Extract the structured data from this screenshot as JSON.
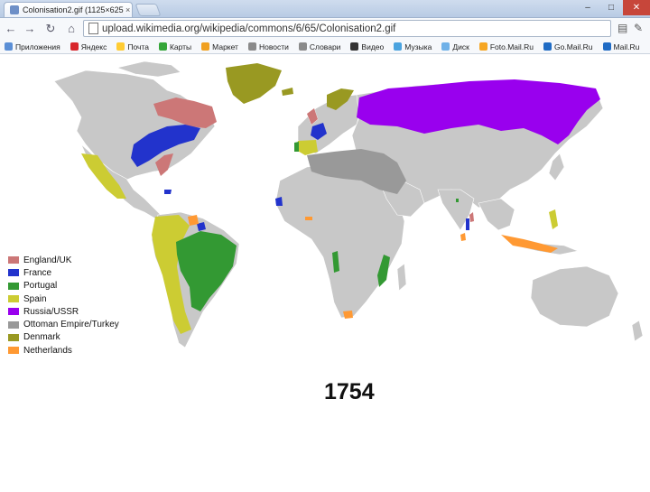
{
  "browser": {
    "tab_title": "Colonisation2.gif (1125×625)",
    "tab_close": "×",
    "url": "upload.wikimedia.org/wikipedia/commons/6/65/Colonisation2.gif",
    "window_controls": {
      "minimize": "–",
      "maximize": "□",
      "close": "✕"
    },
    "nav": {
      "back": "←",
      "forward": "→",
      "reload": "↻",
      "home": "⌂"
    },
    "right_icons": {
      "page": "▤",
      "wrench": "✎"
    }
  },
  "bookmarks": [
    {
      "label": "Приложения",
      "color": "#5b8fd6",
      "icon": "apps-icon"
    },
    {
      "label": "Яндекс",
      "color": "#d8262b",
      "icon": "yandex-icon"
    },
    {
      "label": "Почта",
      "color": "#ffcc33",
      "icon": "mail-icon"
    },
    {
      "label": "Карты",
      "color": "#35a63a",
      "icon": "maps-icon"
    },
    {
      "label": "Маркет",
      "color": "#f0a020",
      "icon": "market-icon"
    },
    {
      "label": "Новости",
      "color": "#8a8a8a",
      "icon": "news-icon"
    },
    {
      "label": "Словари",
      "color": "#8a8a8a",
      "icon": "dictionary-icon"
    },
    {
      "label": "Видео",
      "color": "#333333",
      "icon": "video-icon"
    },
    {
      "label": "Музыка",
      "color": "#4aa3df",
      "icon": "music-icon"
    },
    {
      "label": "Диск",
      "color": "#6fb1e8",
      "icon": "disk-icon"
    },
    {
      "label": "Foto.Mail.Ru",
      "color": "#f6a623",
      "icon": "foto-mail-icon"
    },
    {
      "label": "Go.Mail.Ru",
      "color": "#1f6bc4",
      "icon": "go-mail-icon"
    },
    {
      "label": "Mail.Ru",
      "color": "#1f6bc4",
      "icon": "mail-ru-icon"
    }
  ],
  "map": {
    "year": "1754",
    "land_color": "#c8c8c8",
    "legend": [
      {
        "label": "England/UK",
        "color": "#cc7777"
      },
      {
        "label": "France",
        "color": "#2233cc"
      },
      {
        "label": "Portugal",
        "color": "#339933"
      },
      {
        "label": "Spain",
        "color": "#cccc33"
      },
      {
        "label": "Russia/USSR",
        "color": "#9900ee"
      },
      {
        "label": "Ottoman Empire/Turkey",
        "color": "#999999"
      },
      {
        "label": "Denmark",
        "color": "#999922"
      },
      {
        "label": "Netherlands",
        "color": "#ff9933"
      }
    ]
  }
}
